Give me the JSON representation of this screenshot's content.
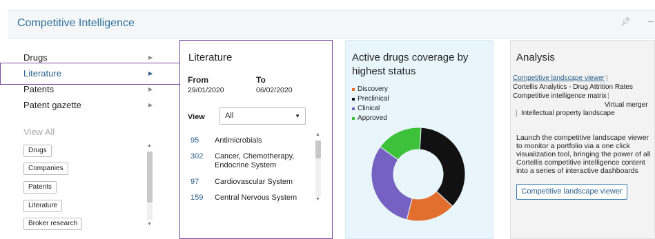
{
  "panel": {
    "title": "Competitive Intelligence"
  },
  "nav": {
    "items": [
      {
        "label": "Drugs"
      },
      {
        "label": "Literature"
      },
      {
        "label": "Patents"
      },
      {
        "label": "Patent gazette"
      }
    ],
    "view_all_title": "View All",
    "view_all_tags": [
      "Drugs",
      "Companies",
      "Patents",
      "Literature",
      "Broker research"
    ]
  },
  "literature": {
    "title": "Literature",
    "from_label": "From",
    "to_label": "To",
    "from_value": "29/01/2020",
    "to_value": "06/02/2020",
    "view_label": "View",
    "view_selected": "All",
    "rows": [
      {
        "count": "95",
        "label": "Antimicrobials"
      },
      {
        "count": "302",
        "label": "Cancer, Chemotherapy, Endocrine System"
      },
      {
        "count": "97",
        "label": "Cardiovascular System"
      },
      {
        "count": "159",
        "label": "Central Nervous System"
      }
    ]
  },
  "coverage": {
    "title": "Active drugs coverage by highest status",
    "legend": [
      {
        "label": "Discovery",
        "color": "#e36f2f"
      },
      {
        "label": "Preclinical",
        "color": "#111111"
      },
      {
        "label": "Clinical",
        "color": "#7461c2"
      },
      {
        "label": "Approved",
        "color": "#3ec13a"
      }
    ],
    "shares": [
      {
        "label": "Preclinical",
        "value": 36
      },
      {
        "label": "Discovery",
        "value": 17
      },
      {
        "label": "Clinical",
        "value": 31
      },
      {
        "label": "Approved",
        "value": 16
      }
    ]
  },
  "analysis": {
    "title": "Analysis",
    "link_text": "Competitive landscape viewer",
    "sep": "|",
    "item2": "Cortellis Analytics - Drug Attrition Rates",
    "item3": "Competitive intelligence matrix",
    "item4": "Virtual merger",
    "item5": "Intellectual property landscape",
    "description": "Launch the competitive landscape viewer to monitor a portfolio via a one click visualization tool, bringing the power of all Cortellis competitive intelligence content into a series of interactive dashboards",
    "button_label": "Competitive landscape viewer"
  },
  "icons": {
    "pin": "pin-icon",
    "collapse": "minimize-icon"
  }
}
